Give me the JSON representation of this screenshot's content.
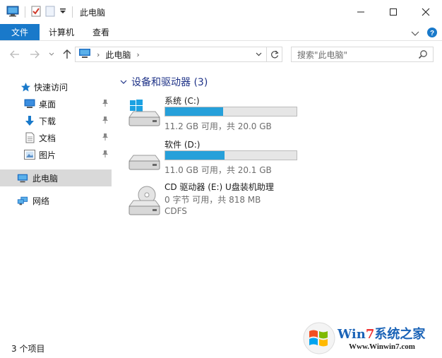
{
  "window": {
    "title": "此电脑",
    "controls": {
      "minimize": "—",
      "maximize": "☐",
      "close": "✕"
    }
  },
  "ribbon": {
    "tabs": [
      {
        "label": "文件",
        "active": true
      },
      {
        "label": "计算机"
      },
      {
        "label": "查看"
      }
    ]
  },
  "address": {
    "path": [
      "此电脑"
    ],
    "search_placeholder": "搜索\"此电脑\""
  },
  "nav": {
    "quick_access": "快速访问",
    "items": [
      {
        "label": "桌面",
        "icon": "desktop-icon",
        "pinned": true
      },
      {
        "label": "下载",
        "icon": "download-icon",
        "pinned": true
      },
      {
        "label": "文档",
        "icon": "document-icon",
        "pinned": true
      },
      {
        "label": "图片",
        "icon": "picture-icon",
        "pinned": true
      }
    ],
    "this_pc": "此电脑",
    "network": "网络"
  },
  "content": {
    "group_title": "设备和驱动器 (3)",
    "drives": [
      {
        "name": "系统 (C:)",
        "info": "11.2 GB 可用，共 20.0 GB",
        "used_fraction": 0.44,
        "icon": "windows-drive-icon"
      },
      {
        "name": "软件 (D:)",
        "info": "11.0 GB 可用，共 20.1 GB",
        "used_fraction": 0.45,
        "icon": "hard-drive-icon"
      },
      {
        "name": "CD 驱动器 (E:) U盘装机助理",
        "info": "0 字节 可用，共 818 MB",
        "fs": "CDFS",
        "icon": "cd-drive-icon"
      }
    ]
  },
  "status": {
    "count": "3 个项目"
  },
  "watermark": {
    "brand_main": "Win",
    "brand_seven": "7",
    "brand_tail": "系统之家",
    "url": "Www.Winwin7.com"
  },
  "colors": {
    "accent": "#1979ca",
    "bar_fill": "#26a0da",
    "group_title": "#1e3287"
  }
}
